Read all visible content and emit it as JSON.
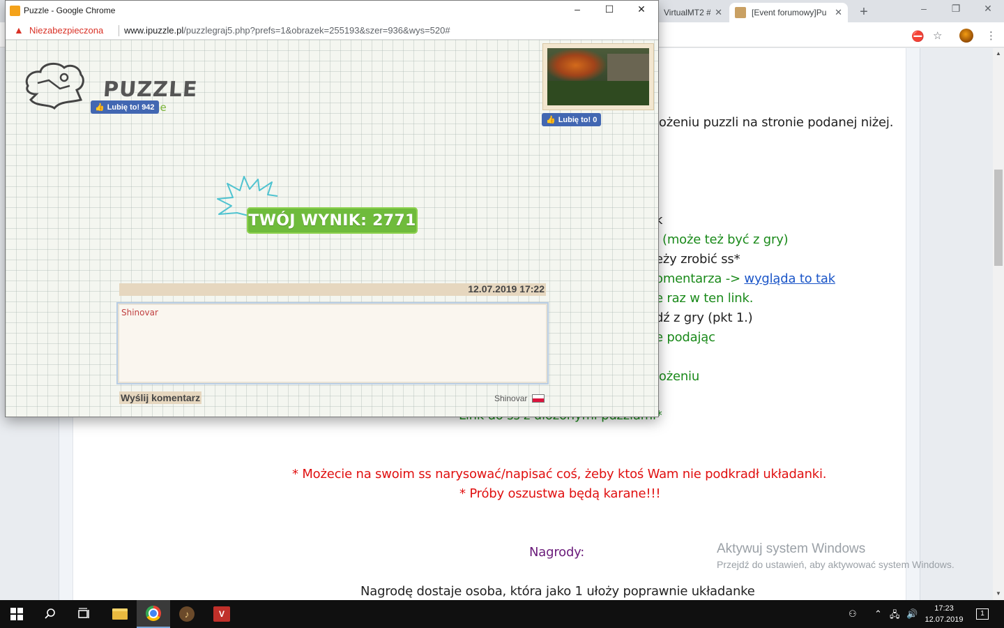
{
  "background_browser": {
    "tabs": [
      {
        "label": "VirtualMT2 #"
      },
      {
        "label": "[Event forumowy]Pu"
      }
    ],
    "new_tab_symbol": "+",
    "window_controls": {
      "minimize": "–",
      "restore": "❐",
      "close": "✕"
    },
    "toolbar_icons": [
      "extension-icon",
      "star-icon",
      "avatar",
      "menu-icon"
    ]
  },
  "page_content": {
    "lines": [
      {
        "text": "łożeniu puzzli na stronie podanej niżej.",
        "color": "dark"
      },
      {
        "text": "k",
        "color": "dark"
      },
      {
        "text": "(może też być z gry)",
        "color": "green"
      },
      {
        "text": "eży zrobić ss*",
        "color": "dark"
      },
      {
        "text_before": "omentarza -> ",
        "link": "wygląda to tak",
        "color": "green"
      },
      {
        "text": "e raz w ten link.",
        "color": "green"
      },
      {
        "text": "dź z gry (pkt 1.)",
        "color": "dark"
      },
      {
        "text": "e podając",
        "color": "green"
      },
      {
        "text": "łożeniu",
        "color": "green"
      },
      {
        "text": "Link do ss z ułożonymi puzzlami*",
        "color": "green"
      },
      {
        "text": "* Możecie na swoim ss narysować/napisać coś, żeby ktoś Wam nie podkradł układanki.",
        "color": "red"
      },
      {
        "text": "* Próby oszustwa będą karane!!!",
        "color": "red"
      },
      {
        "text": "Nagrody:",
        "color": "purple"
      },
      {
        "text": "Nagrodę dostaje osoba, która jako 1 ułoży poprawnie układanke",
        "color": "dark"
      }
    ]
  },
  "watermark": {
    "title": "Aktywuj system Windows",
    "subtitle": "Przejdź do ustawień, aby aktywować system Windows."
  },
  "popup": {
    "title": "Puzzle - Google Chrome",
    "window_controls": {
      "minimize": "–",
      "maximize": "☐",
      "close": "✕"
    },
    "security_label": "Niezabezpieczona",
    "url_host": "www.ipuzzle.pl",
    "url_path": "/puzzlegraj5.php?prefs=1&obrazek=255193&szer=936&wys=520#",
    "logo": {
      "main": "PUZZLE",
      "sub": "online"
    },
    "like_button_site": "Lubię to! 942",
    "like_button_image": "Lubię to! 0",
    "score_text": "TWÓJ WYNIK: 2771",
    "comment_date": "12.07.2019 17:22",
    "comment_value": "Shinovar",
    "send_button": "Wyślij komentarz",
    "nickname": "Shinovar"
  },
  "taskbar": {
    "items": [
      "windows-start",
      "search",
      "task-view",
      "file-explorer",
      "chrome",
      "game-app-1",
      "game-app-2"
    ],
    "active": "chrome",
    "time": "17:23",
    "date": "12.07.2019",
    "notification_count": "1"
  }
}
